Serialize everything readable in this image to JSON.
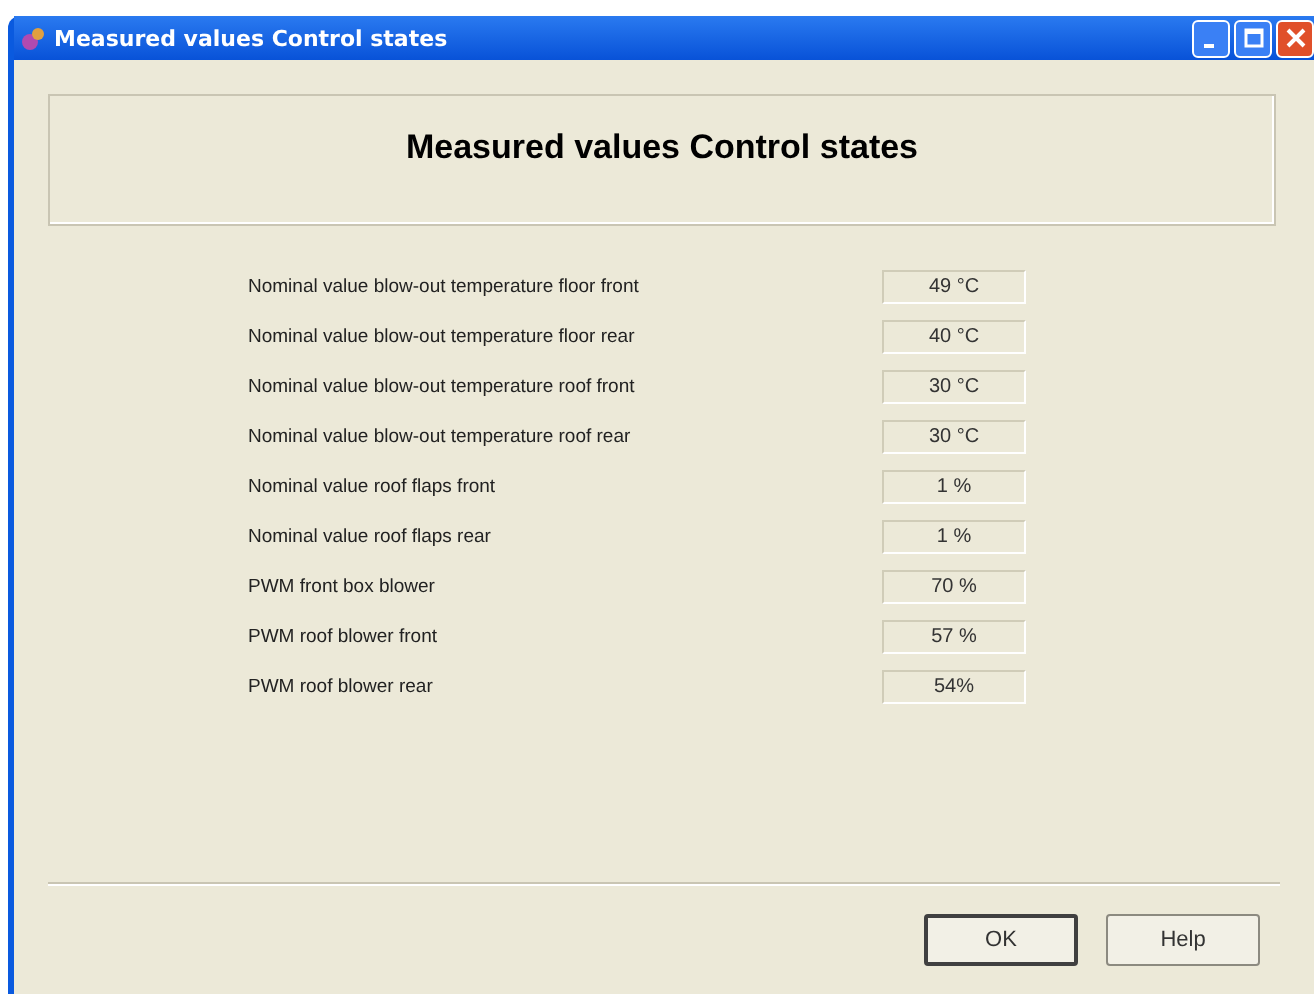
{
  "window": {
    "title": "Measured values Control states"
  },
  "heading": "Measured values Control states",
  "rows": [
    {
      "label": "Nominal value blow-out temperature floor front",
      "value": "49 °C"
    },
    {
      "label": "Nominal value blow-out temperature floor rear",
      "value": "40 °C"
    },
    {
      "label": "Nominal value blow-out temperature roof front",
      "value": "30 °C"
    },
    {
      "label": "Nominal value blow-out temperature roof rear",
      "value": "30 °C"
    },
    {
      "label": "Nominal value roof flaps front",
      "value": "1 %"
    },
    {
      "label": "Nominal value roof flaps rear",
      "value": "1 %"
    },
    {
      "label": "PWM front box blower",
      "value": "70 %"
    },
    {
      "label": "PWM roof blower front",
      "value": "57 %"
    },
    {
      "label": "PWM roof blower rear",
      "value": "54%"
    }
  ],
  "buttons": [
    {
      "label": "OK",
      "default": true
    },
    {
      "label": "Help",
      "default": false
    }
  ]
}
